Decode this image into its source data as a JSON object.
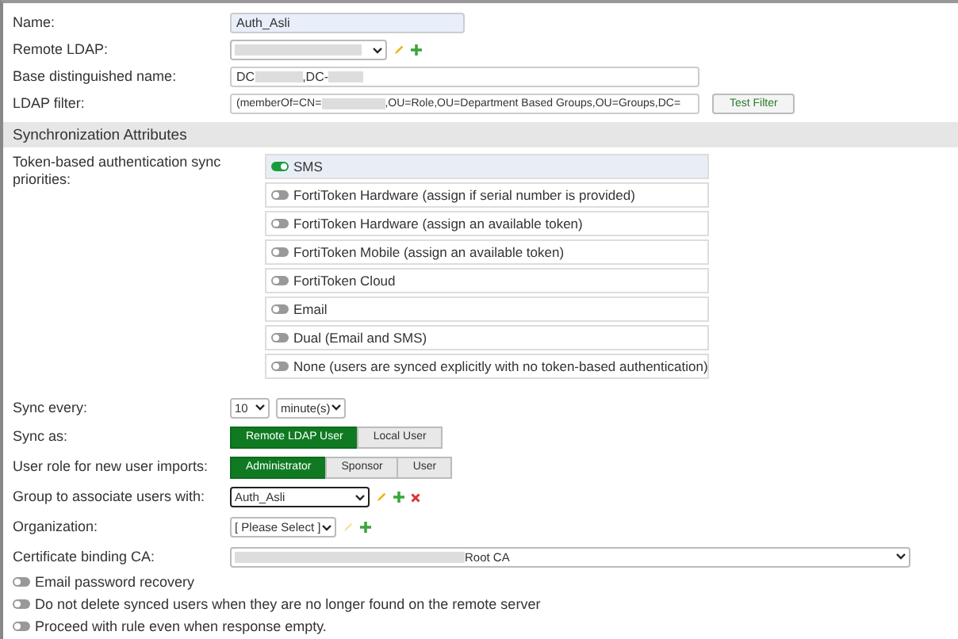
{
  "fields": [
    {
      "kind": "input",
      "label": "Name:",
      "value": "Auth_Asli"
    },
    {
      "kind": "select_actions",
      "label": "Remote LDAP:"
    },
    {
      "kind": "redacted_input",
      "label": "Base distinguished name:",
      "segments": [
        "DC",
        ",DC-"
      ]
    },
    {
      "kind": "filter",
      "label": "LDAP filter:",
      "segments": [
        "(memberOf=CN=",
        ",OU=Role,OU=Department Based Groups,OU=Groups,DC="
      ],
      "button": "Test Filter"
    }
  ],
  "section": {
    "title": "Synchronization Attributes"
  },
  "priorities": {
    "label": "Token-based authentication sync priorities:",
    "items": [
      {
        "label": "SMS",
        "on": true
      },
      {
        "label": "FortiToken Hardware (assign if serial number is provided)",
        "on": false
      },
      {
        "label": "FortiToken Hardware (assign an available token)",
        "on": false
      },
      {
        "label": "FortiToken Mobile (assign an available token)",
        "on": false
      },
      {
        "label": "FortiToken Cloud",
        "on": false
      },
      {
        "label": "Email",
        "on": false
      },
      {
        "label": "Dual (Email and SMS)",
        "on": false
      },
      {
        "label": "None (users are synced explicitly with no token-based authentication)",
        "on": false
      }
    ]
  },
  "sync_every": {
    "label": "Sync every:",
    "value": "10",
    "unit": "minute(s)"
  },
  "sync_as": {
    "label": "Sync as:",
    "options": [
      {
        "label": "Remote LDAP User",
        "selected": true
      },
      {
        "label": "Local User",
        "selected": false
      }
    ]
  },
  "user_role": {
    "label": "User role for new user imports:",
    "options": [
      {
        "label": "Administrator",
        "selected": true
      },
      {
        "label": "Sponsor",
        "selected": false
      },
      {
        "label": "User",
        "selected": false
      }
    ]
  },
  "group": {
    "label": "Group to associate users with:",
    "value": "Auth_Asli"
  },
  "organization": {
    "label": "Organization:",
    "value": "[ Please Select ]"
  },
  "certificate": {
    "label": "Certificate binding CA:",
    "value": "Root CA"
  },
  "options": [
    {
      "label": "Email password recovery",
      "on": false
    },
    {
      "label": "Do not delete synced users when they are no longer found on the remote server",
      "on": false
    },
    {
      "label": "Proceed with rule even when response empty.",
      "on": false
    }
  ]
}
